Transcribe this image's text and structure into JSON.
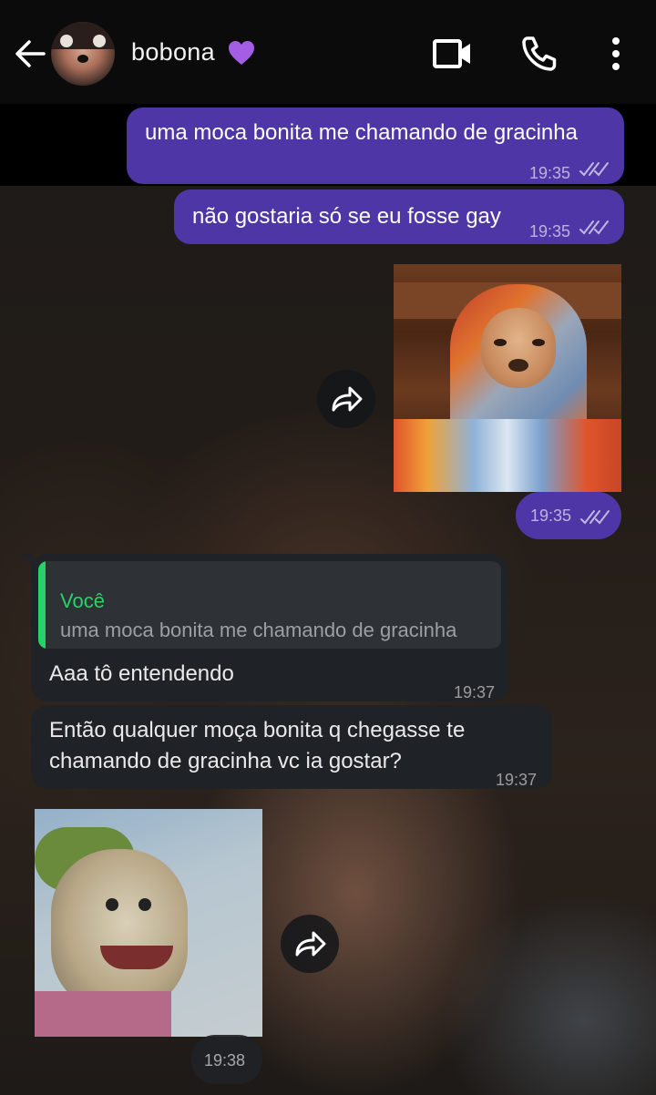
{
  "header": {
    "contact_name": "bobona",
    "icons": [
      "arrow-back-icon",
      "purple-heart-icon",
      "video-camera-icon",
      "phone-icon",
      "more-vertical-icon"
    ]
  },
  "messages": [
    {
      "direction": "out",
      "text": "uma moca bonita me chamando de gracinha",
      "time": "19:35",
      "status": "read"
    },
    {
      "direction": "out",
      "text": "não gostaria só se eu fosse gay",
      "time": "19:35",
      "status": "read"
    },
    {
      "direction": "out",
      "type": "sticker",
      "time": "19:35",
      "status": "read"
    },
    {
      "direction": "in",
      "reply_to": {
        "author": "Você",
        "text": "uma moca bonita me chamando de gracinha"
      },
      "text": "Aaa tô entendendo",
      "time": "19:37"
    },
    {
      "direction": "in",
      "text_lines": [
        "Então qualquer moça bonita q chegasse te",
        "chamando de gracinha vc ia gostar?"
      ],
      "time": "19:37"
    },
    {
      "direction": "in",
      "type": "sticker",
      "time": "19:38"
    }
  ],
  "colors": {
    "outgoing_bubble": "#4f36a6",
    "incoming_bubble": "#1f2226",
    "quote_accent": "#25d366",
    "header_bg": "#0b0b0b"
  }
}
